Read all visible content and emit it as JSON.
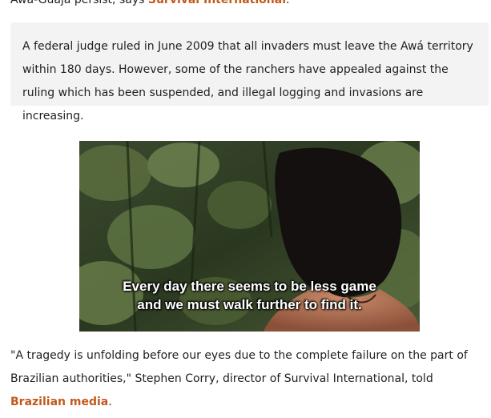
{
  "article": {
    "top_line_text": "Awá-Guajá persist, says ",
    "top_line_link": "Survival International",
    "top_line_end": ".",
    "quote": "A federal judge ruled in June 2009 that all invaders must leave the Awá territory within 180 days. However, some of the ranchers have appealed against the ruling which has been suspended, and illegal logging and invasions are increasing.",
    "video": {
      "caption_line1": "Every day there seems to be less game",
      "caption_line2": "and we must walk further to find it."
    },
    "paragraph_text": "\"A tragedy is unfolding before our eyes due to the complete failure on the part of Brazilian authorities,\" Stephen Corry, director of Survival International, told ",
    "paragraph_link": "Brazilian media",
    "paragraph_end": "."
  },
  "colors": {
    "link": "#c25a1b",
    "quote_background": "#f3f3f3"
  }
}
